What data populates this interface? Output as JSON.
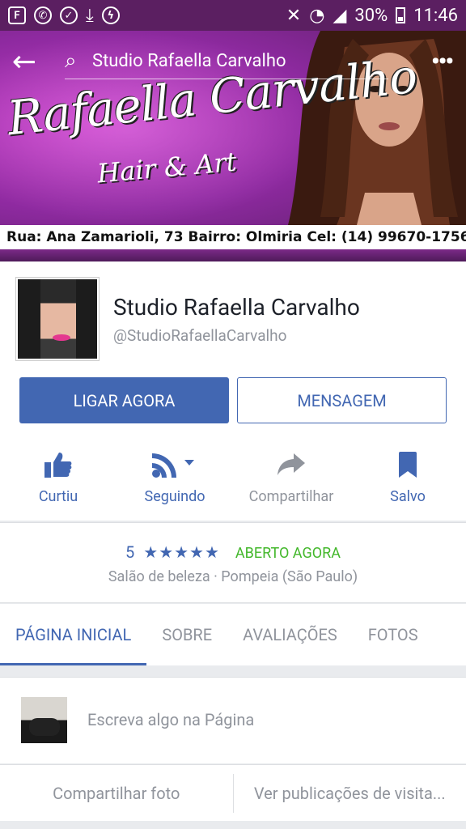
{
  "status_bar": {
    "battery": "30%",
    "time": "11:46",
    "icons": [
      "flipboard-icon",
      "whatsapp-icon",
      "shield-icon",
      "download-icon",
      "messenger-icon"
    ]
  },
  "cover": {
    "title_script": "Rafaella Carvalho",
    "subtitle_script": "Hair & Art",
    "address": "Rua: Ana Zamarioli, 73  Bairro: Olmiria  Cel: (14) 99670-1756"
  },
  "topbar": {
    "search_value": "Studio Rafaella Carvalho"
  },
  "profile": {
    "name": "Studio Rafaella Carvalho",
    "handle": "@StudioRafaellaCarvalho",
    "call_button": "LIGAR AGORA",
    "message_button": "MENSAGEM"
  },
  "actions": [
    {
      "label": "Curtiu",
      "icon": "thumbs-up-icon"
    },
    {
      "label": "Seguindo",
      "icon": "rss-icon"
    },
    {
      "label": "Compartilhar",
      "icon": "share-icon"
    },
    {
      "label": "Salvo",
      "icon": "bookmark-icon"
    }
  ],
  "rating": {
    "score": "5",
    "stars": "★★★★★",
    "open_status": "ABERTO AGORA",
    "category": "Salão de beleza · Pompeia (São Paulo)"
  },
  "tabs": [
    "PÁGINA INICIAL",
    "SOBRE",
    "AVALIAÇÕES",
    "FOTOS"
  ],
  "composer": {
    "placeholder": "Escreva algo na Página",
    "share_photo": "Compartilhar foto",
    "visitor_posts": "Ver publicações de visita..."
  },
  "colors": {
    "accent": "#4267b2",
    "open_green": "#42b72a",
    "cover_purple": "#8e2aa0"
  }
}
